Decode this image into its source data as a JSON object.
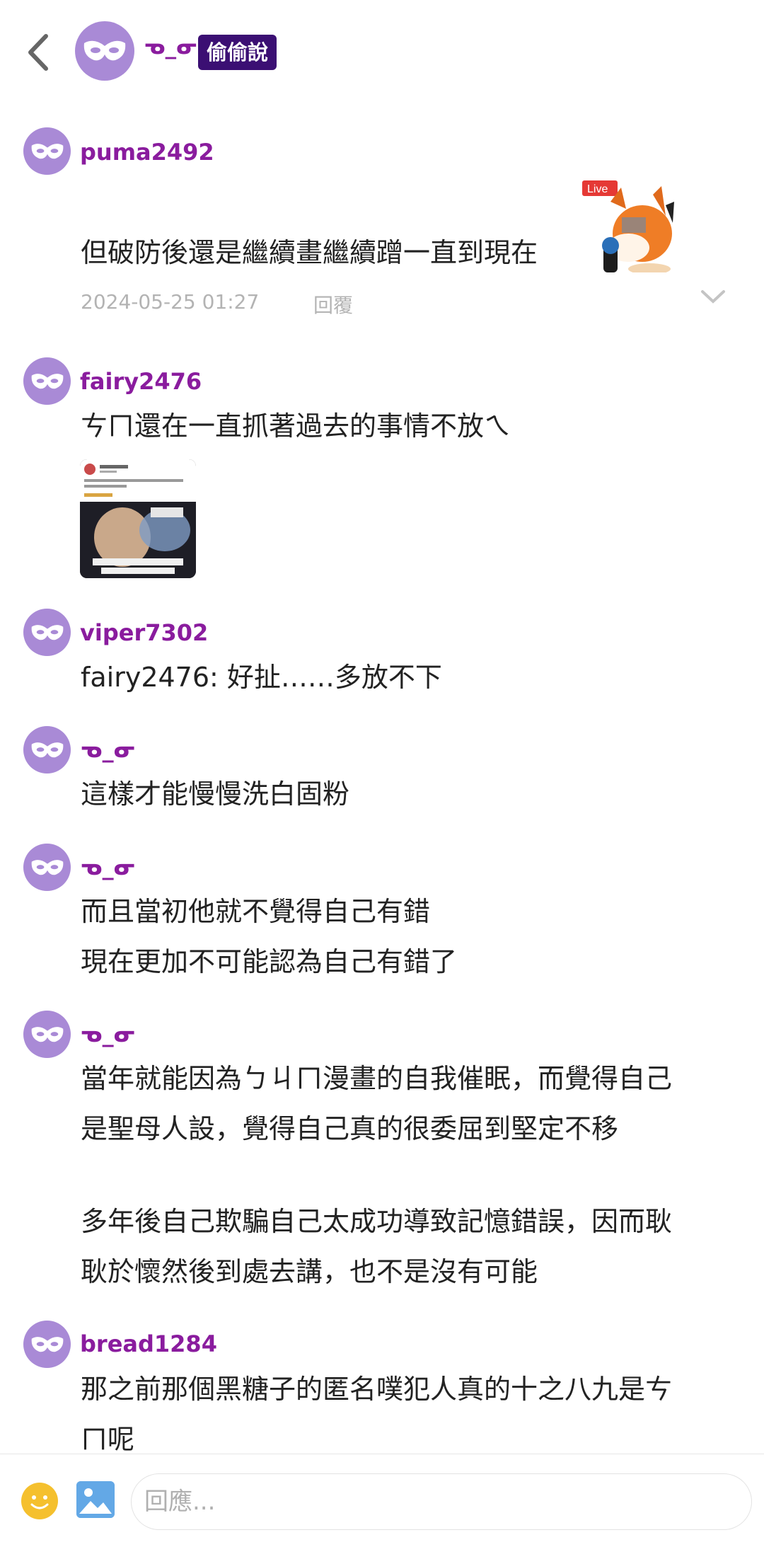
{
  "header": {
    "name": "ᓀ_ᓂ",
    "badge": "偷偷說"
  },
  "comments": [
    {
      "username": "puma2492",
      "lines": [
        "但破防後還是繼續畫繼續蹭一直到現在"
      ],
      "timestamp": "2024-05-25 01:27",
      "reply_label": "回覆",
      "sticker_label": "Live"
    },
    {
      "username": "fairy2476",
      "lines": [
        "ㄘㄇ還在一直抓著過去的事情不放ㄟ"
      ]
    },
    {
      "username": "viper7302",
      "lines": [
        "fairy2476: 好扯……多放不下"
      ]
    },
    {
      "username": "ᓀ_ᓂ",
      "lines": [
        "這樣才能慢慢洗白固粉"
      ]
    },
    {
      "username": "ᓀ_ᓂ",
      "lines": [
        "而且當初他就不覺得自己有錯",
        "現在更加不可能認為自己有錯了"
      ]
    },
    {
      "username": "ᓀ_ᓂ",
      "lines": [
        "當年就能因為ㄅㄐㄇ漫畫的自我催眠，而覺得自己",
        "是聖母人設，覺得自己真的很委屈到堅定不移",
        "",
        "多年後自己欺騙自己太成功導致記憶錯誤，因而耿",
        "耿於懷然後到處去講，也不是沒有可能"
      ]
    },
    {
      "username": "bread1284",
      "lines": [
        "那之前那個黑糖子的匿名噗犯人真的十之八九是ㄘ",
        "ㄇ呢"
      ]
    }
  ],
  "input": {
    "placeholder": "回應..."
  },
  "colors": {
    "username": "#8a1c9e",
    "avatar": "#a98ad6",
    "badge_bg": "#3b0f73"
  }
}
